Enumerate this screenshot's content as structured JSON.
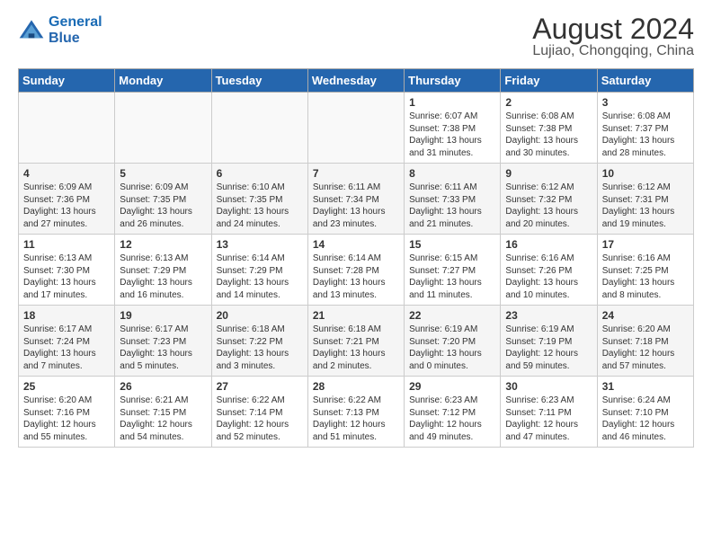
{
  "header": {
    "logo_line1": "General",
    "logo_line2": "Blue",
    "month_year": "August 2024",
    "location": "Lujiao, Chongqing, China"
  },
  "weekdays": [
    "Sunday",
    "Monday",
    "Tuesday",
    "Wednesday",
    "Thursday",
    "Friday",
    "Saturday"
  ],
  "weeks": [
    [
      {
        "day": "",
        "content": ""
      },
      {
        "day": "",
        "content": ""
      },
      {
        "day": "",
        "content": ""
      },
      {
        "day": "",
        "content": ""
      },
      {
        "day": "1",
        "content": "Sunrise: 6:07 AM\nSunset: 7:38 PM\nDaylight: 13 hours\nand 31 minutes."
      },
      {
        "day": "2",
        "content": "Sunrise: 6:08 AM\nSunset: 7:38 PM\nDaylight: 13 hours\nand 30 minutes."
      },
      {
        "day": "3",
        "content": "Sunrise: 6:08 AM\nSunset: 7:37 PM\nDaylight: 13 hours\nand 28 minutes."
      }
    ],
    [
      {
        "day": "4",
        "content": "Sunrise: 6:09 AM\nSunset: 7:36 PM\nDaylight: 13 hours\nand 27 minutes."
      },
      {
        "day": "5",
        "content": "Sunrise: 6:09 AM\nSunset: 7:35 PM\nDaylight: 13 hours\nand 26 minutes."
      },
      {
        "day": "6",
        "content": "Sunrise: 6:10 AM\nSunset: 7:35 PM\nDaylight: 13 hours\nand 24 minutes."
      },
      {
        "day": "7",
        "content": "Sunrise: 6:11 AM\nSunset: 7:34 PM\nDaylight: 13 hours\nand 23 minutes."
      },
      {
        "day": "8",
        "content": "Sunrise: 6:11 AM\nSunset: 7:33 PM\nDaylight: 13 hours\nand 21 minutes."
      },
      {
        "day": "9",
        "content": "Sunrise: 6:12 AM\nSunset: 7:32 PM\nDaylight: 13 hours\nand 20 minutes."
      },
      {
        "day": "10",
        "content": "Sunrise: 6:12 AM\nSunset: 7:31 PM\nDaylight: 13 hours\nand 19 minutes."
      }
    ],
    [
      {
        "day": "11",
        "content": "Sunrise: 6:13 AM\nSunset: 7:30 PM\nDaylight: 13 hours\nand 17 minutes."
      },
      {
        "day": "12",
        "content": "Sunrise: 6:13 AM\nSunset: 7:29 PM\nDaylight: 13 hours\nand 16 minutes."
      },
      {
        "day": "13",
        "content": "Sunrise: 6:14 AM\nSunset: 7:29 PM\nDaylight: 13 hours\nand 14 minutes."
      },
      {
        "day": "14",
        "content": "Sunrise: 6:14 AM\nSunset: 7:28 PM\nDaylight: 13 hours\nand 13 minutes."
      },
      {
        "day": "15",
        "content": "Sunrise: 6:15 AM\nSunset: 7:27 PM\nDaylight: 13 hours\nand 11 minutes."
      },
      {
        "day": "16",
        "content": "Sunrise: 6:16 AM\nSunset: 7:26 PM\nDaylight: 13 hours\nand 10 minutes."
      },
      {
        "day": "17",
        "content": "Sunrise: 6:16 AM\nSunset: 7:25 PM\nDaylight: 13 hours\nand 8 minutes."
      }
    ],
    [
      {
        "day": "18",
        "content": "Sunrise: 6:17 AM\nSunset: 7:24 PM\nDaylight: 13 hours\nand 7 minutes."
      },
      {
        "day": "19",
        "content": "Sunrise: 6:17 AM\nSunset: 7:23 PM\nDaylight: 13 hours\nand 5 minutes."
      },
      {
        "day": "20",
        "content": "Sunrise: 6:18 AM\nSunset: 7:22 PM\nDaylight: 13 hours\nand 3 minutes."
      },
      {
        "day": "21",
        "content": "Sunrise: 6:18 AM\nSunset: 7:21 PM\nDaylight: 13 hours\nand 2 minutes."
      },
      {
        "day": "22",
        "content": "Sunrise: 6:19 AM\nSunset: 7:20 PM\nDaylight: 13 hours\nand 0 minutes."
      },
      {
        "day": "23",
        "content": "Sunrise: 6:19 AM\nSunset: 7:19 PM\nDaylight: 12 hours\nand 59 minutes."
      },
      {
        "day": "24",
        "content": "Sunrise: 6:20 AM\nSunset: 7:18 PM\nDaylight: 12 hours\nand 57 minutes."
      }
    ],
    [
      {
        "day": "25",
        "content": "Sunrise: 6:20 AM\nSunset: 7:16 PM\nDaylight: 12 hours\nand 55 minutes."
      },
      {
        "day": "26",
        "content": "Sunrise: 6:21 AM\nSunset: 7:15 PM\nDaylight: 12 hours\nand 54 minutes."
      },
      {
        "day": "27",
        "content": "Sunrise: 6:22 AM\nSunset: 7:14 PM\nDaylight: 12 hours\nand 52 minutes."
      },
      {
        "day": "28",
        "content": "Sunrise: 6:22 AM\nSunset: 7:13 PM\nDaylight: 12 hours\nand 51 minutes."
      },
      {
        "day": "29",
        "content": "Sunrise: 6:23 AM\nSunset: 7:12 PM\nDaylight: 12 hours\nand 49 minutes."
      },
      {
        "day": "30",
        "content": "Sunrise: 6:23 AM\nSunset: 7:11 PM\nDaylight: 12 hours\nand 47 minutes."
      },
      {
        "day": "31",
        "content": "Sunrise: 6:24 AM\nSunset: 7:10 PM\nDaylight: 12 hours\nand 46 minutes."
      }
    ]
  ]
}
